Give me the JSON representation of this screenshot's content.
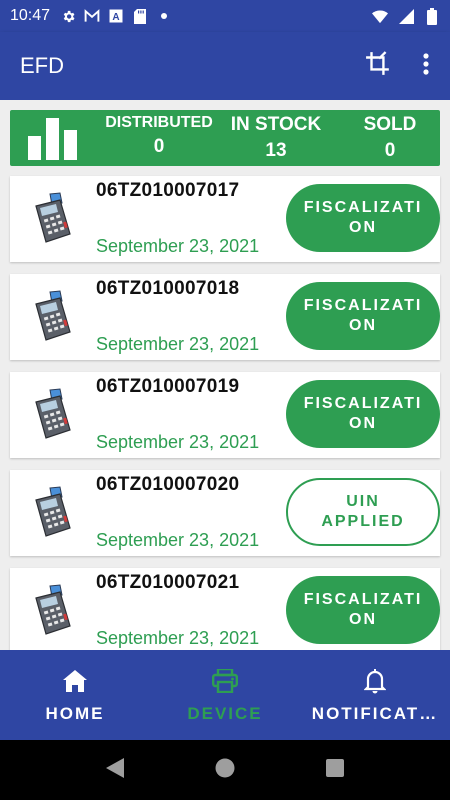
{
  "status_bar": {
    "time": "10:47",
    "icons": [
      "gear-icon",
      "gmail-icon",
      "a-icon",
      "sd-card-icon",
      "dot-icon"
    ],
    "right_icons": [
      "wifi-icon",
      "signal-icon",
      "battery-icon"
    ]
  },
  "app_bar": {
    "title": "EFD",
    "actions": [
      "crop-icon",
      "more-vert-icon"
    ]
  },
  "summary": {
    "distributed_label": "DISTRIBUTED",
    "distributed_value": "0",
    "instock_label": "IN STOCK",
    "instock_value": "13",
    "sold_label": "SOLD",
    "sold_value": "0"
  },
  "devices": [
    {
      "serial": "06TZ010007017",
      "date": "September 23, 2021",
      "status": "FISCALIZATION"
    },
    {
      "serial": "06TZ010007018",
      "date": "September 23, 2021",
      "status": "FISCALIZATION"
    },
    {
      "serial": "06TZ010007019",
      "date": "September 23, 2021",
      "status": "FISCALIZATION"
    },
    {
      "serial": "06TZ010007020",
      "date": "September 23, 2021",
      "status": "UIN APPLIED"
    },
    {
      "serial": "06TZ010007021",
      "date": "September 23, 2021",
      "status": "FISCALIZATION"
    }
  ],
  "bottom_nav": {
    "home": "HOME",
    "device": "DEVICE",
    "notifications": "NOTIFICAT…"
  },
  "colors": {
    "primary": "#2f46a3",
    "accent": "#2e9e52",
    "background": "#eeeeee"
  }
}
